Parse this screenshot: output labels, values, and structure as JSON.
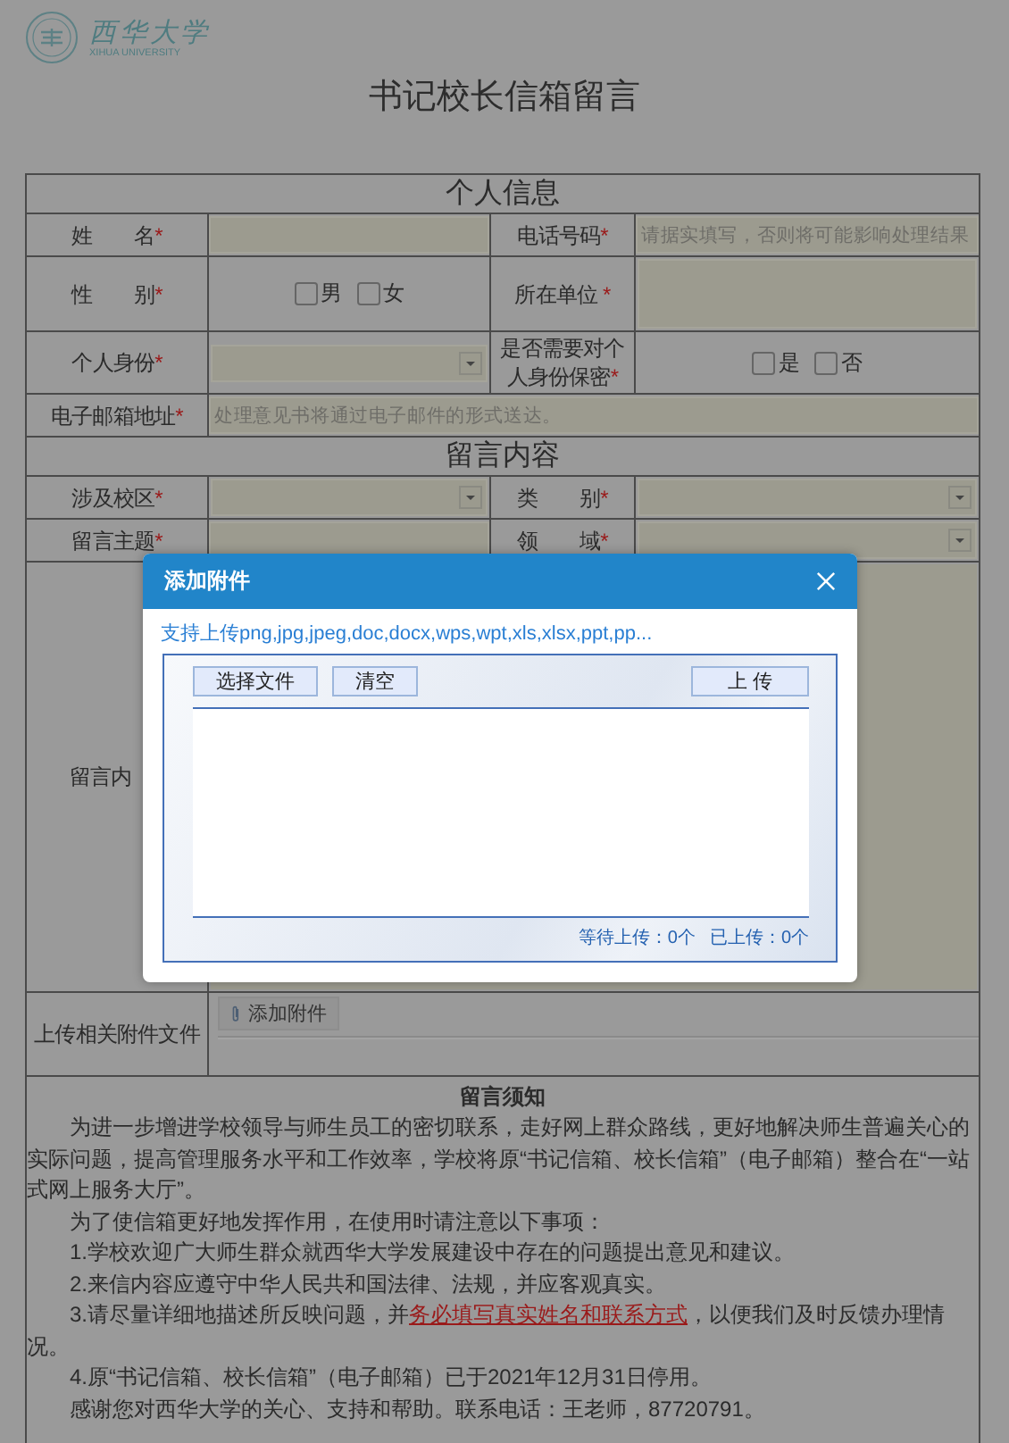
{
  "logo": {
    "name": "西华大学",
    "subtitle": "XIHUA UNIVERSITY"
  },
  "title": "书记校长信箱留言",
  "sections": [
    {
      "heading": "个人信息",
      "rows": [
        [
          {
            "kind": "label",
            "text": "姓　　名",
            "mark": "*"
          },
          {
            "kind": "input"
          },
          {
            "kind": "label",
            "text": "电话号码",
            "mark": "*"
          },
          {
            "kind": "input",
            "placeholder": "请据实填写，否则将可能影响处理结果"
          }
        ],
        [
          {
            "kind": "label",
            "text": "性　　别",
            "mark": "*"
          },
          {
            "kind": "checks",
            "options": [
              {
                "label": "男",
                "checked": false
              },
              {
                "label": "女",
                "checked": false
              }
            ]
          },
          {
            "kind": "label",
            "text": "所在单位 ",
            "mark": "*"
          },
          {
            "kind": "area"
          }
        ],
        [
          {
            "kind": "label",
            "text": "个人身份",
            "mark": "*"
          },
          {
            "kind": "select"
          },
          {
            "kind": "label",
            "text": "是否需要对个人身份保密",
            "mark": "*"
          },
          {
            "kind": "checks",
            "options": [
              {
                "label": "是",
                "checked": false
              },
              {
                "label": "否",
                "checked": false
              }
            ]
          }
        ],
        [
          {
            "kind": "label",
            "text": "电子邮箱地址",
            "mark": "*"
          },
          {
            "kind": "input",
            "colspan": 3,
            "placeholder": "处理意见书将通过电子邮件的形式送达。"
          }
        ]
      ]
    },
    {
      "heading": "留言内容",
      "rows": [
        [
          {
            "kind": "label",
            "text": "涉及校区",
            "mark": "*"
          },
          {
            "kind": "select"
          },
          {
            "kind": "label",
            "text": "类　　别",
            "mark": "*"
          },
          {
            "kind": "select"
          }
        ],
        [
          {
            "kind": "label",
            "text": "留言主题",
            "mark": "*"
          },
          {
            "kind": "input"
          },
          {
            "kind": "label",
            "text": "领　　域",
            "mark": "*"
          },
          {
            "kind": "select"
          }
        ],
        [
          {
            "kind": "label",
            "text": "留言内"
          },
          {
            "kind": "editor",
            "colspan": 3
          }
        ],
        [
          {
            "kind": "label",
            "text": "上传相关附件文件"
          },
          {
            "kind": "upload",
            "colspan": 3,
            "button": "添加附件"
          }
        ]
      ]
    }
  ],
  "notice": {
    "title": "留言须知",
    "paragraphs": [
      [
        {
          "text": "为进一步增进学校领导与师生员工的密切联系，走好网上群众路线，更好地解决师生普遍关心的实际问题，提高管理服务水平和工作效率，学校将原“书记信箱、校长信箱”（电子邮箱）整合在“一站式网上服务大厅”。"
        }
      ],
      [
        {
          "text": "为了使信箱更好地发挥作用，在使用时请注意以下事项："
        }
      ],
      [
        {
          "text": "1.学校欢迎广大师生群众就西华大学发展建设中存在的问题提出意见和建议。"
        }
      ],
      [
        {
          "text": "2.来信内容应遵守中华人民共和国法律、法规，并应客观真实。"
        }
      ],
      [
        {
          "text": "3.请尽量详细地描述所反映问题，并"
        },
        {
          "text": "务必填写真实姓名和联系方式",
          "kind": "link"
        },
        {
          "text": "，以便我们及时反馈办理情况。"
        }
      ],
      [
        {
          "text": "4.原“书记信箱、校长信箱”（电子邮箱）已于2021年12月31日停用。"
        }
      ],
      [
        {
          "text": "感谢您对西华大学的关心、支持和帮助。联系电话：王老师，87720791。"
        }
      ]
    ]
  },
  "dialog": {
    "title": "添加附件",
    "hint": "支持上传png,jpg,jpeg,doc,docx,wps,wpt,xls,xlsx,ppt,pp...",
    "buttons": [
      "选择文件",
      "清空"
    ],
    "upload_button": "上 传",
    "status": [
      "等待上传：0个",
      "已上传：0个"
    ]
  }
}
